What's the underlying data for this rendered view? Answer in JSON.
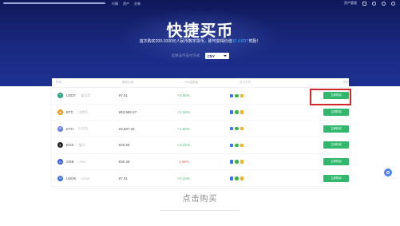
{
  "nav": {
    "links": [
      "行情",
      "资产",
      "交易"
    ],
    "account": "资产管理",
    "icons": [
      "download-icon",
      "bell-icon",
      "user-icon",
      "globe-icon"
    ]
  },
  "hero": {
    "title": "快捷买币",
    "subtitle_prefix": "首次购买200-1000元人民币数字货币，即可获得价值",
    "subtitle_highlight": "10 USDT",
    "subtitle_suffix": "奖励！",
    "currency_label": "选择法币支付方式",
    "currency_value": "CNY"
  },
  "table": {
    "headers": [
      "币种",
      "最新价格",
      "24H涨跌幅",
      "支付方式",
      "操作"
    ],
    "rows": [
      {
        "symbol": "USDT",
        "name": "泰达币",
        "price": "¥7.01",
        "change": "+0.00%",
        "direction": "up",
        "icon_color": "#26a17b",
        "icon_glyph": "T",
        "action": "立即购买"
      },
      {
        "symbol": "BTC",
        "name": "比特币",
        "price": "¥63,985.57",
        "change": "+2.16%",
        "direction": "up",
        "icon_color": "#f7931a",
        "icon_glyph": "B",
        "action": "立即购买"
      },
      {
        "symbol": "ETH",
        "name": "以太坊",
        "price": "¥3,687.36",
        "change": "+1.90%",
        "direction": "up",
        "icon_color": "#627eea",
        "icon_glyph": "E",
        "action": "立即购买"
      },
      {
        "symbol": "EOS",
        "name": "柚子",
        "price": "¥26.58",
        "change": "+3.41%",
        "direction": "up",
        "icon_color": "#222222",
        "icon_glyph": "e",
        "action": "立即购买"
      },
      {
        "symbol": "OKB",
        "name": "OKB",
        "price": "¥30.45",
        "change": "-1.48%",
        "direction": "down",
        "icon_color": "#2f5ae5",
        "icon_glyph": "O",
        "action": "立即购买"
      },
      {
        "symbol": "USDK",
        "name": "USDK",
        "price": "¥7.01",
        "change": "+0.10%",
        "direction": "up",
        "icon_color": "#3d6fe6",
        "icon_glyph": "U",
        "action": "立即购买"
      }
    ]
  },
  "caption": "点击购买",
  "colors": {
    "hero_top": "#10185a",
    "hero_bottom": "#1d3191",
    "buy_button": "#32b86c",
    "highlight": "#d6272d",
    "up": "#3fbe78",
    "down": "#ef5a5a"
  }
}
